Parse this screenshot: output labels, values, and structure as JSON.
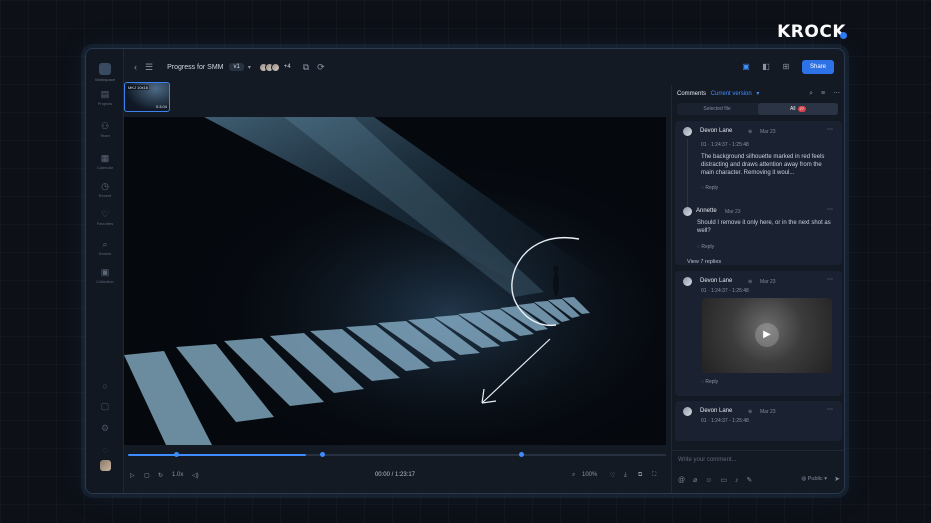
{
  "brand": {
    "name": "KROCK"
  },
  "rail": {
    "workspace_label": "Workspace",
    "items": [
      {
        "icon": "folder-icon",
        "glyph": "▤",
        "label": "Projects"
      },
      {
        "icon": "users-icon",
        "glyph": "⚇",
        "label": "Team"
      },
      {
        "icon": "calendar-icon",
        "glyph": "▦",
        "label": "Calendar"
      },
      {
        "icon": "clock-icon",
        "glyph": "◷",
        "label": "Recent"
      },
      {
        "icon": "heart-icon",
        "glyph": "♡",
        "label": "Favorites"
      },
      {
        "icon": "search-icon",
        "glyph": "⌕",
        "label": "Search"
      },
      {
        "icon": "collection-icon",
        "glyph": "▣",
        "label": "Collection"
      }
    ]
  },
  "topbar": {
    "project_title": "Progress for SMM",
    "version": "v1",
    "collaborators_more": "+4",
    "share_label": "Share"
  },
  "thumbnail": {
    "tag": "MKJ 10x16",
    "time": "0:3.04"
  },
  "player": {
    "current_time": "00:00",
    "duration": "1:23:17",
    "timecode": "00:00 / 1:23:17",
    "speed": "1.0x",
    "zoom": "100%",
    "progress": 0.33,
    "comment_markers": [
      0.09,
      0.36,
      0.73
    ]
  },
  "comments_panel": {
    "title": "Comments",
    "version_filter": "Current version",
    "tabs": {
      "selected": "Selected file",
      "all": "All",
      "all_count": "27"
    },
    "thread1": {
      "author": "Devon Lane",
      "date": "Mar 23",
      "timestamp": "01 · 1:24:37 - 1:25:48",
      "text": "The background silhouette marked in red feels distracting and draws attention away from the main character. Removing it woul...",
      "reply_label": "Reply",
      "reply_author": "Annette",
      "reply_date": "Mar 23",
      "reply_text": "Should I remove it only here, or in the next shot as well?",
      "reply_reply_label": "Reply",
      "view_replies": "View 7 replies"
    },
    "thread2": {
      "author": "Devon Lane",
      "date": "Mar 23",
      "timestamp": "01 · 1:24:37 - 1:25:48",
      "reply_label": "Reply"
    },
    "thread3": {
      "author": "Devon Lane",
      "date": "Mar 23",
      "timestamp": "01 · 1:24:37 - 1:25:48"
    },
    "composer": {
      "placeholder": "Write your comment...",
      "visibility": "Public"
    }
  },
  "colors": {
    "accent": "#3f8cff",
    "share_button": "#2e72e8",
    "badge": "#d9434b",
    "panel_bg": "#141a24"
  }
}
